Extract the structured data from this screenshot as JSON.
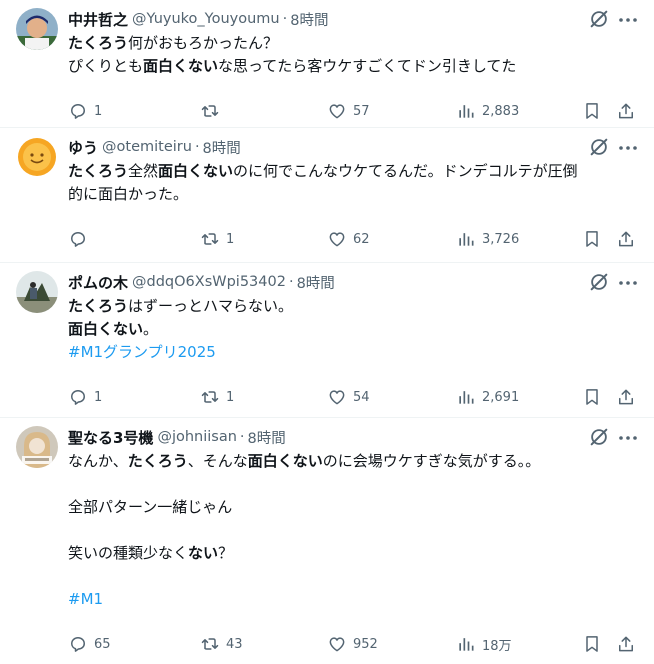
{
  "tweets": [
    {
      "name": "中井哲之",
      "handle": "@Yuyuko_Youyoumu",
      "sep": "·",
      "time": "8時間",
      "lines": [
        [
          {
            "t": "たくろう",
            "b": true
          },
          {
            "t": "何がおもろかったん？"
          }
        ],
        [
          {
            "t": "ぴくりとも"
          },
          {
            "t": "面白くない",
            "b": true
          },
          {
            "t": "な思ってたら客ウケすごくてドン引きしてた"
          }
        ]
      ],
      "stats": {
        "reply": "1",
        "retweet": "",
        "like": "57",
        "views": "2,883"
      }
    },
    {
      "name": "ゆう",
      "handle": "@otemiteiru",
      "sep": "·",
      "time": "8時間",
      "lines": [
        [
          {
            "t": "たくろう",
            "b": true
          },
          {
            "t": "全然"
          },
          {
            "t": "面白くない",
            "b": true
          },
          {
            "t": "のに何でこんなウケてるんだ。ドンデコルテが圧倒"
          }
        ],
        [
          {
            "t": "的に面白かった。"
          }
        ]
      ],
      "stats": {
        "reply": "",
        "retweet": "1",
        "like": "62",
        "views": "3,726"
      }
    },
    {
      "name": "ポムの木",
      "handle": "@ddqO6XsWpi53402",
      "sep": "·",
      "time": "8時間",
      "lines": [
        [
          {
            "t": "たくろう",
            "b": true
          },
          {
            "t": "はずーっとハマらない。"
          }
        ],
        [
          {
            "t": "面白くない",
            "b": true
          },
          {
            "t": "。"
          }
        ],
        [
          {
            "t": " #M1グランプリ2025",
            "h": true
          }
        ]
      ],
      "stats": {
        "reply": "1",
        "retweet": "1",
        "like": "54",
        "views": "2,691"
      }
    },
    {
      "name": "聖なる3号機",
      "handle": "@johniisan",
      "sep": "·",
      "time": "8時間",
      "lines": [
        [
          {
            "t": "なんか、"
          },
          {
            "t": "たくろう",
            "b": true
          },
          {
            "t": "、そんな"
          },
          {
            "t": "面白くない",
            "b": true
          },
          {
            "t": "のに会場ウケすぎな気がする。。"
          }
        ],
        [],
        [
          {
            "t": "全部パターン一緒じゃん"
          }
        ],
        [],
        [
          {
            "t": "笑いの種類少なく"
          },
          {
            "t": "ない",
            "b": true
          },
          {
            "t": "？"
          }
        ],
        [],
        [
          {
            "t": "#M1",
            "h": true
          }
        ]
      ],
      "stats": {
        "reply": "65",
        "retweet": "43",
        "like": "952",
        "views": "18万"
      }
    }
  ],
  "icons": {
    "grok": "grok-icon",
    "more": "more-icon",
    "reply": "reply-icon",
    "retweet": "retweet-icon",
    "like": "like-icon",
    "views": "views-icon",
    "bookmark": "bookmark-icon",
    "share": "share-icon"
  },
  "colors": {
    "text": "#0f1419",
    "secondary": "#536471",
    "link": "#1d9bf0",
    "divider": "#eff3f4"
  }
}
